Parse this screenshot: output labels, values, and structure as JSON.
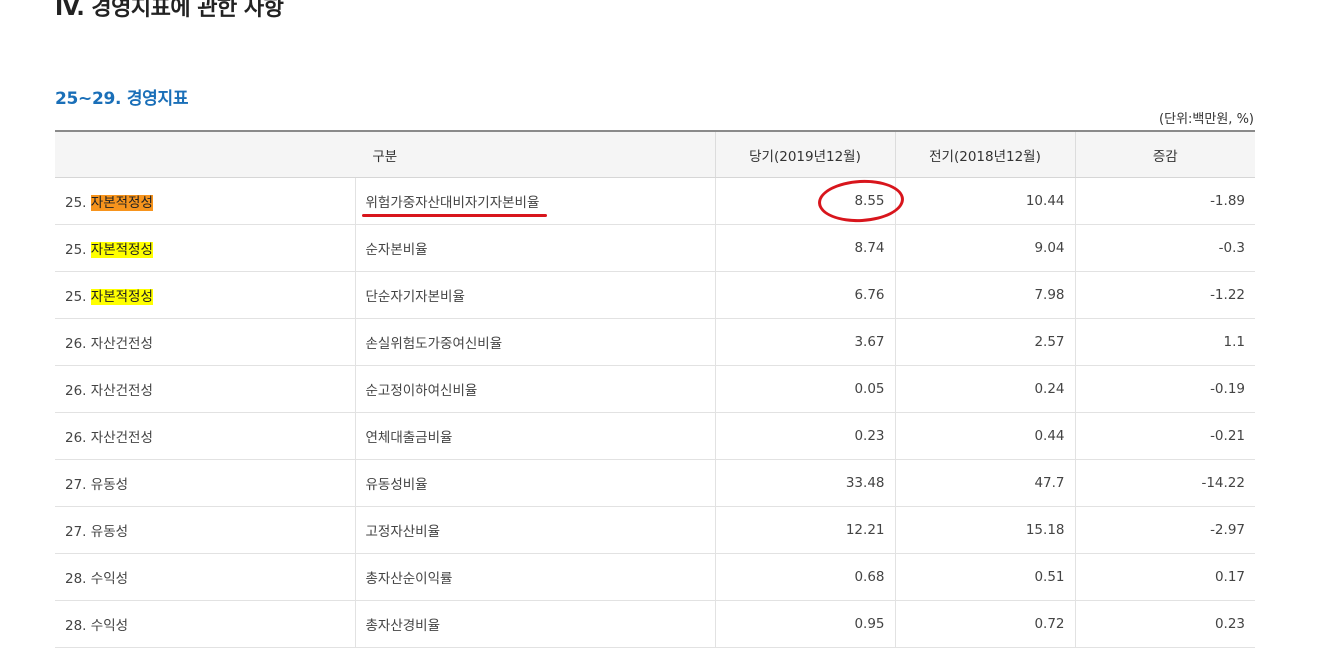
{
  "page": {
    "heading": "IV. 경영지표에 관한 사항",
    "section_title": "25~29. 경영지표",
    "unit_note": "(단위:백만원, %)"
  },
  "table": {
    "headers": [
      "구분",
      "당기(2019년12월)",
      "전기(2018년12월)",
      "증감"
    ],
    "rows": [
      {
        "cat_prefix": "25.",
        "cat_label": "자본적정성",
        "highlight": "orange",
        "item": "위험가중자산대비자기자본비율",
        "current": "8.55",
        "previous": "10.44",
        "change": "-1.89"
      },
      {
        "cat_prefix": "25.",
        "cat_label": "자본적정성",
        "highlight": "yellow",
        "item": "순자본비율",
        "current": "8.74",
        "previous": "9.04",
        "change": "-0.3"
      },
      {
        "cat_prefix": "25.",
        "cat_label": "자본적정성",
        "highlight": "yellow",
        "item": "단순자기자본비율",
        "current": "6.76",
        "previous": "7.98",
        "change": "-1.22"
      },
      {
        "cat_prefix": "26.",
        "cat_label": "자산건전성",
        "highlight": "none",
        "item": "손실위험도가중여신비율",
        "current": "3.67",
        "previous": "2.57",
        "change": "1.1"
      },
      {
        "cat_prefix": "26.",
        "cat_label": "자산건전성",
        "highlight": "none",
        "item": "순고정이하여신비율",
        "current": "0.05",
        "previous": "0.24",
        "change": "-0.19"
      },
      {
        "cat_prefix": "26.",
        "cat_label": "자산건전성",
        "highlight": "none",
        "item": "연체대출금비율",
        "current": "0.23",
        "previous": "0.44",
        "change": "-0.21"
      },
      {
        "cat_prefix": "27.",
        "cat_label": "유동성",
        "highlight": "none",
        "item": "유동성비율",
        "current": "33.48",
        "previous": "47.7",
        "change": "-14.22"
      },
      {
        "cat_prefix": "27.",
        "cat_label": "유동성",
        "highlight": "none",
        "item": "고정자산비율",
        "current": "12.21",
        "previous": "15.18",
        "change": "-2.97"
      },
      {
        "cat_prefix": "28.",
        "cat_label": "수익성",
        "highlight": "none",
        "item": "총자산순이익률",
        "current": "0.68",
        "previous": "0.51",
        "change": "0.17"
      },
      {
        "cat_prefix": "28.",
        "cat_label": "수익성",
        "highlight": "none",
        "item": "총자산경비율",
        "current": "0.95",
        "previous": "0.72",
        "change": "0.23"
      }
    ]
  },
  "colors": {
    "highlight_orange": "#f7941d",
    "highlight_yellow": "#ffff00",
    "annotation_red": "#d8151c",
    "section_blue": "#1a6fb8"
  }
}
